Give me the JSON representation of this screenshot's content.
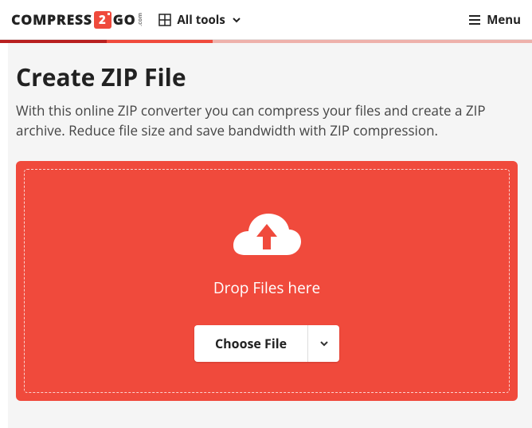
{
  "brand": {
    "pre": "COMPRESS",
    "badge": "2",
    "post": "GO",
    "suffix": ".com"
  },
  "nav": {
    "all_tools": "All tools",
    "menu": "Menu"
  },
  "page": {
    "title": "Create ZIP File",
    "description": "With this online ZIP converter you can compress your files and create a ZIP archive. Reduce file size and save bandwidth with ZIP compression."
  },
  "dropzone": {
    "drop_label": "Drop Files here",
    "choose_label": "Choose File"
  },
  "colors": {
    "accent": "#f04a3c"
  }
}
